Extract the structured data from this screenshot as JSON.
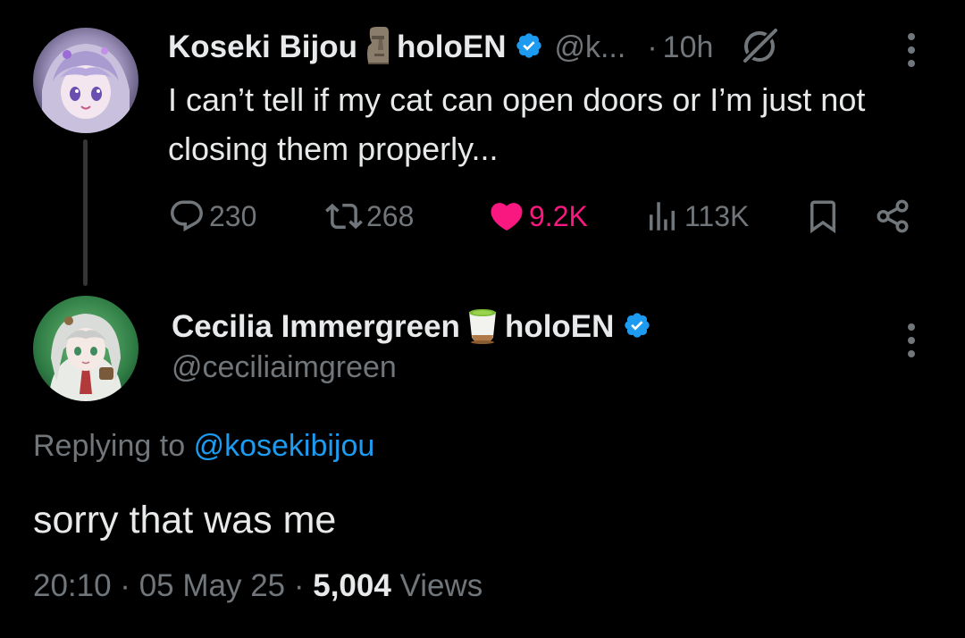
{
  "parent_tweet": {
    "display_name": "Koseki Bijou",
    "name_suffix": "holoEN",
    "handle": "@k...",
    "separator": "·",
    "time": "10h",
    "text": "I can’t tell if my cat can open doors or I’m just not closing them properly...",
    "actions": {
      "replies": "230",
      "reposts": "268",
      "likes": "9.2K",
      "views": "113K"
    }
  },
  "reply_tweet": {
    "display_name": "Cecilia Immergreen",
    "name_suffix": "holoEN",
    "handle": "@ceciliaimgreen",
    "replying_to_label": "Replying to",
    "replying_to_handle": "@kosekibijou",
    "text": "sorry that was me",
    "timestamp": "20:10 · 05 May 25 · ",
    "views_count": "5,004",
    "views_label": " Views"
  },
  "colors": {
    "background": "#000000",
    "text_primary": "#e7e9ea",
    "text_secondary": "#71767b",
    "accent_blue": "#1d9bf0",
    "like_pink": "#f91880",
    "thread_line": "#333639"
  },
  "icons": {
    "verified": "verified-badge-icon",
    "moai": "moai-emoji-icon",
    "tea": "matcha-tea-emoji-icon",
    "grok": "grok-icon",
    "more": "more-options-icon",
    "reply": "reply-icon",
    "repost": "repost-icon",
    "like": "heart-icon",
    "views": "views-icon",
    "bookmark": "bookmark-icon",
    "share": "share-icon"
  }
}
